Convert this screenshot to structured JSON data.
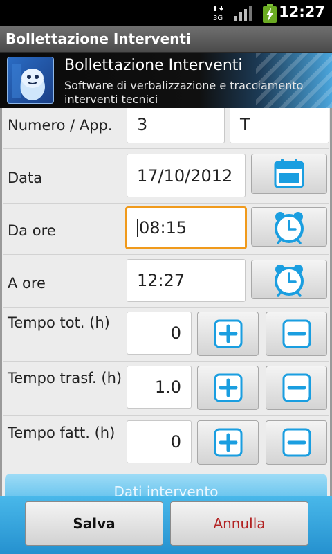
{
  "status_bar": {
    "time": "12:27",
    "network": "3G",
    "icons": [
      "network-3g-icon",
      "signal-icon",
      "battery-charging-icon"
    ]
  },
  "titlebar": {
    "title": "Bollettazione Interventi"
  },
  "banner": {
    "title": "Bollettazione Interventi",
    "subtitle": "Software di verbalizzazione e tracciamento interventi tecnici"
  },
  "form": {
    "numero": {
      "label": "Numero / App.",
      "value": "3",
      "app": "T"
    },
    "data": {
      "label": "Data",
      "value": "17/10/2012",
      "icon": "calendar-icon"
    },
    "da_ore": {
      "label": "Da ore",
      "value": "08:15",
      "icon": "alarm-clock-icon"
    },
    "a_ore": {
      "label": "A ore",
      "value": "12:27",
      "icon": "alarm-clock-icon"
    },
    "tempo_tot": {
      "label": "Tempo tot. (h)",
      "value": "0"
    },
    "tempo_trasf": {
      "label": "Tempo trasf. (h)",
      "value": "1.0"
    },
    "tempo_fatt": {
      "label": "Tempo fatt. (h)",
      "value": "0"
    },
    "dati_label": "Dati intervento"
  },
  "actions": {
    "save": "Salva",
    "cancel": "Annulla"
  },
  "colors": {
    "accent": "#3aa8e0",
    "focus": "#f09a1c",
    "cancel_text": "#b22222"
  }
}
